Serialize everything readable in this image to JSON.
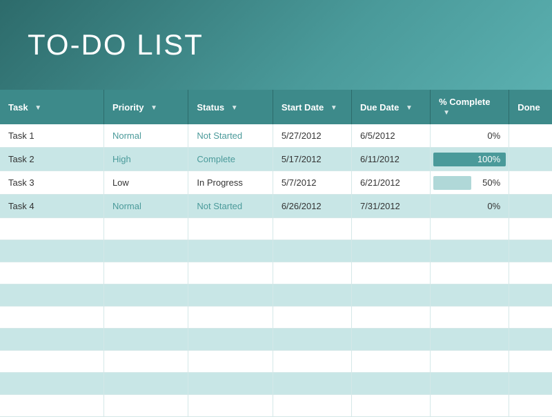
{
  "header": {
    "title": "TO-DO LIST"
  },
  "table": {
    "columns": [
      {
        "id": "task",
        "label": "Task",
        "filterable": true
      },
      {
        "id": "priority",
        "label": "Priority",
        "filterable": true
      },
      {
        "id": "status",
        "label": "Status",
        "filterable": true
      },
      {
        "id": "start_date",
        "label": "Start Date",
        "filterable": true
      },
      {
        "id": "due_date",
        "label": "Due Date",
        "filterable": true
      },
      {
        "id": "pct_complete",
        "label": "% Complete",
        "filterable": true
      },
      {
        "id": "done",
        "label": "Done",
        "filterable": false
      }
    ],
    "rows": [
      {
        "task": "Task 1",
        "priority": "Normal",
        "priority_class": "priority-normal",
        "status": "Not Started",
        "status_class": "status-not-started",
        "start_date": "5/27/2012",
        "due_date": "6/5/2012",
        "pct_complete": "0%",
        "progress": 0
      },
      {
        "task": "Task 2",
        "priority": "High",
        "priority_class": "priority-high",
        "status": "Complete",
        "status_class": "status-complete",
        "start_date": "5/17/2012",
        "due_date": "6/11/2012",
        "pct_complete": "100%",
        "progress": 100
      },
      {
        "task": "Task 3",
        "priority": "Low",
        "priority_class": "priority-low",
        "status": "In Progress",
        "status_class": "status-in-progress",
        "start_date": "5/7/2012",
        "due_date": "6/21/2012",
        "pct_complete": "50%",
        "progress": 50
      },
      {
        "task": "Task 4",
        "priority": "Normal",
        "priority_class": "priority-normal",
        "status": "Not Started",
        "status_class": "status-not-started",
        "start_date": "6/26/2012",
        "due_date": "7/31/2012",
        "pct_complete": "0%",
        "progress": 0
      }
    ],
    "empty_row_count": 9
  }
}
